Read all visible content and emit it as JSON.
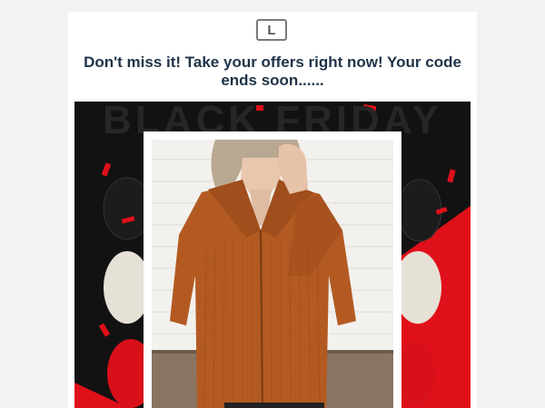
{
  "logo": {
    "letter": "L"
  },
  "headline": "Don't miss it! Take your offers right now! Your code ends soon......",
  "hero": {
    "banner_text": "BLACK FRIDAY",
    "colors": {
      "background": "#121212",
      "accent_red": "#e0101a",
      "balloon_black": "#1a1a1a",
      "balloon_white": "#e8e4da",
      "sweater": "#b35a22"
    },
    "photo": {
      "icon": "model-in-sweater-photo"
    }
  }
}
